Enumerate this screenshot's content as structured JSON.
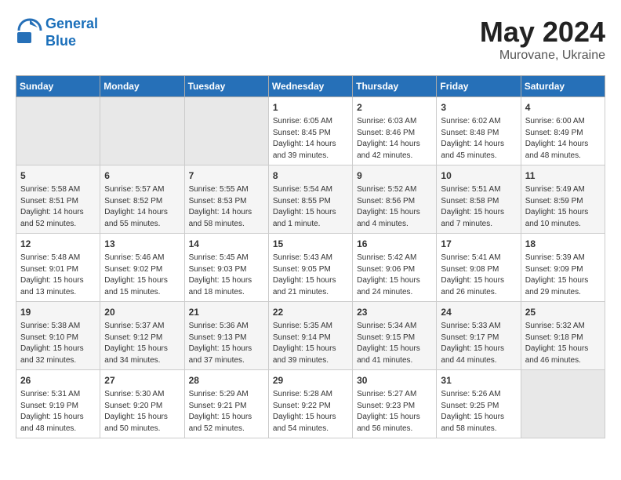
{
  "logo": {
    "line1": "General",
    "line2": "Blue"
  },
  "title": "May 2024",
  "subtitle": "Murovane, Ukraine",
  "days_of_week": [
    "Sunday",
    "Monday",
    "Tuesday",
    "Wednesday",
    "Thursday",
    "Friday",
    "Saturday"
  ],
  "weeks": [
    [
      {
        "day": "",
        "info": ""
      },
      {
        "day": "",
        "info": ""
      },
      {
        "day": "",
        "info": ""
      },
      {
        "day": "1",
        "info": "Sunrise: 6:05 AM\nSunset: 8:45 PM\nDaylight: 14 hours\nand 39 minutes."
      },
      {
        "day": "2",
        "info": "Sunrise: 6:03 AM\nSunset: 8:46 PM\nDaylight: 14 hours\nand 42 minutes."
      },
      {
        "day": "3",
        "info": "Sunrise: 6:02 AM\nSunset: 8:48 PM\nDaylight: 14 hours\nand 45 minutes."
      },
      {
        "day": "4",
        "info": "Sunrise: 6:00 AM\nSunset: 8:49 PM\nDaylight: 14 hours\nand 48 minutes."
      }
    ],
    [
      {
        "day": "5",
        "info": "Sunrise: 5:58 AM\nSunset: 8:51 PM\nDaylight: 14 hours\nand 52 minutes."
      },
      {
        "day": "6",
        "info": "Sunrise: 5:57 AM\nSunset: 8:52 PM\nDaylight: 14 hours\nand 55 minutes."
      },
      {
        "day": "7",
        "info": "Sunrise: 5:55 AM\nSunset: 8:53 PM\nDaylight: 14 hours\nand 58 minutes."
      },
      {
        "day": "8",
        "info": "Sunrise: 5:54 AM\nSunset: 8:55 PM\nDaylight: 15 hours\nand 1 minute."
      },
      {
        "day": "9",
        "info": "Sunrise: 5:52 AM\nSunset: 8:56 PM\nDaylight: 15 hours\nand 4 minutes."
      },
      {
        "day": "10",
        "info": "Sunrise: 5:51 AM\nSunset: 8:58 PM\nDaylight: 15 hours\nand 7 minutes."
      },
      {
        "day": "11",
        "info": "Sunrise: 5:49 AM\nSunset: 8:59 PM\nDaylight: 15 hours\nand 10 minutes."
      }
    ],
    [
      {
        "day": "12",
        "info": "Sunrise: 5:48 AM\nSunset: 9:01 PM\nDaylight: 15 hours\nand 13 minutes."
      },
      {
        "day": "13",
        "info": "Sunrise: 5:46 AM\nSunset: 9:02 PM\nDaylight: 15 hours\nand 15 minutes."
      },
      {
        "day": "14",
        "info": "Sunrise: 5:45 AM\nSunset: 9:03 PM\nDaylight: 15 hours\nand 18 minutes."
      },
      {
        "day": "15",
        "info": "Sunrise: 5:43 AM\nSunset: 9:05 PM\nDaylight: 15 hours\nand 21 minutes."
      },
      {
        "day": "16",
        "info": "Sunrise: 5:42 AM\nSunset: 9:06 PM\nDaylight: 15 hours\nand 24 minutes."
      },
      {
        "day": "17",
        "info": "Sunrise: 5:41 AM\nSunset: 9:08 PM\nDaylight: 15 hours\nand 26 minutes."
      },
      {
        "day": "18",
        "info": "Sunrise: 5:39 AM\nSunset: 9:09 PM\nDaylight: 15 hours\nand 29 minutes."
      }
    ],
    [
      {
        "day": "19",
        "info": "Sunrise: 5:38 AM\nSunset: 9:10 PM\nDaylight: 15 hours\nand 32 minutes."
      },
      {
        "day": "20",
        "info": "Sunrise: 5:37 AM\nSunset: 9:12 PM\nDaylight: 15 hours\nand 34 minutes."
      },
      {
        "day": "21",
        "info": "Sunrise: 5:36 AM\nSunset: 9:13 PM\nDaylight: 15 hours\nand 37 minutes."
      },
      {
        "day": "22",
        "info": "Sunrise: 5:35 AM\nSunset: 9:14 PM\nDaylight: 15 hours\nand 39 minutes."
      },
      {
        "day": "23",
        "info": "Sunrise: 5:34 AM\nSunset: 9:15 PM\nDaylight: 15 hours\nand 41 minutes."
      },
      {
        "day": "24",
        "info": "Sunrise: 5:33 AM\nSunset: 9:17 PM\nDaylight: 15 hours\nand 44 minutes."
      },
      {
        "day": "25",
        "info": "Sunrise: 5:32 AM\nSunset: 9:18 PM\nDaylight: 15 hours\nand 46 minutes."
      }
    ],
    [
      {
        "day": "26",
        "info": "Sunrise: 5:31 AM\nSunset: 9:19 PM\nDaylight: 15 hours\nand 48 minutes."
      },
      {
        "day": "27",
        "info": "Sunrise: 5:30 AM\nSunset: 9:20 PM\nDaylight: 15 hours\nand 50 minutes."
      },
      {
        "day": "28",
        "info": "Sunrise: 5:29 AM\nSunset: 9:21 PM\nDaylight: 15 hours\nand 52 minutes."
      },
      {
        "day": "29",
        "info": "Sunrise: 5:28 AM\nSunset: 9:22 PM\nDaylight: 15 hours\nand 54 minutes."
      },
      {
        "day": "30",
        "info": "Sunrise: 5:27 AM\nSunset: 9:23 PM\nDaylight: 15 hours\nand 56 minutes."
      },
      {
        "day": "31",
        "info": "Sunrise: 5:26 AM\nSunset: 9:25 PM\nDaylight: 15 hours\nand 58 minutes."
      },
      {
        "day": "",
        "info": ""
      }
    ]
  ]
}
